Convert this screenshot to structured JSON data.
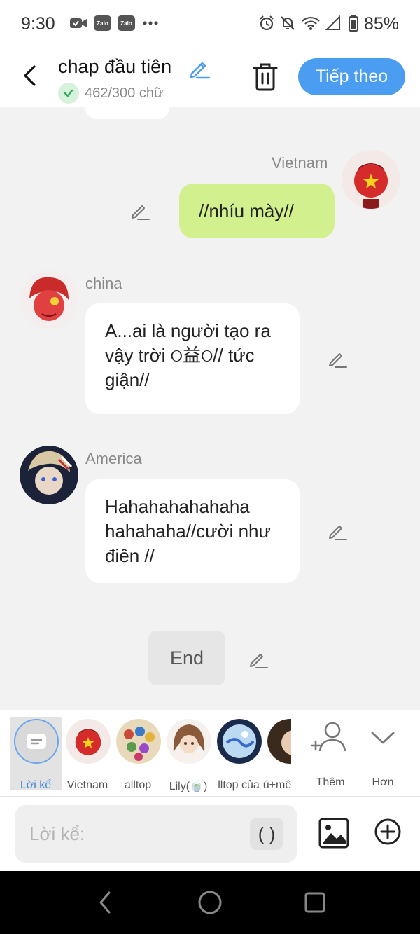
{
  "status_bar": {
    "time": "9:30",
    "app_icons": [
      "video-icon",
      "zalo-icon",
      "zalo-icon",
      "more-dots-icon"
    ],
    "zalo_label": "Zalo",
    "system_icons": [
      "alarm-icon",
      "mute-icon",
      "wifi-icon",
      "signal-icon",
      "battery-icon"
    ],
    "battery": "85%"
  },
  "header": {
    "title": "chap đầu tiên",
    "word_count": "462/300 chữ",
    "next_button": "Tiếp theo"
  },
  "messages": [
    {
      "speaker": "Vietnam",
      "text": "//nhíu mày//",
      "side": "right"
    },
    {
      "speaker": "china",
      "text": "A...ai là người tạo ra vậy trời ଠ益ଠ// tức giận//",
      "side": "left"
    },
    {
      "speaker": "America",
      "text": "Hahahahahahaha hahahaha//cười như điên //",
      "side": "left"
    }
  ],
  "end_label": "End",
  "characters": [
    {
      "label": "Lời kể",
      "selected": true
    },
    {
      "label": "Vietnam",
      "selected": false
    },
    {
      "label": "alltop",
      "selected": false
    },
    {
      "label": "Lily(🍵)",
      "selected": false
    },
    {
      "label": "lltop của",
      "selected": false
    },
    {
      "label": "ú+mê",
      "selected": false
    }
  ],
  "picker_actions": {
    "add": "Thêm",
    "more": "Hơn"
  },
  "input": {
    "placeholder": "Lời kể:",
    "value": "",
    "paren_button": "( )"
  },
  "colors": {
    "accent": "#4a9df0",
    "my_bubble": "#d3f08f",
    "bubble": "#ffffff",
    "background": "#f2f2f2"
  }
}
